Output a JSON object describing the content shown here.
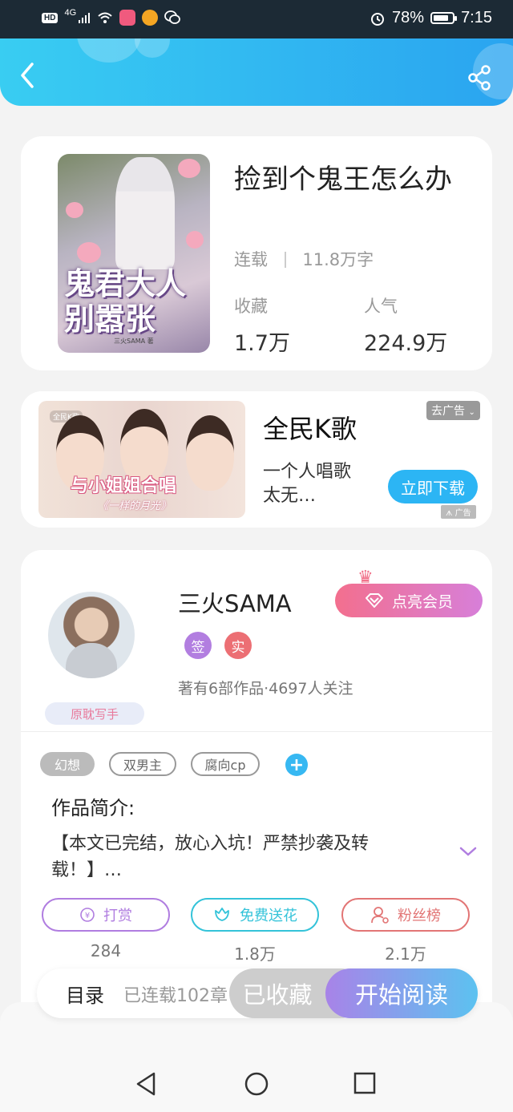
{
  "status_bar": {
    "left_labels": [
      "HD",
      "4G"
    ],
    "battery": "78%",
    "time": "7:15"
  },
  "header": {
    "back_icon": "chevron-left-icon",
    "share_icon": "share-icon"
  },
  "book": {
    "cover_title": "鬼君大人别嚣张",
    "cover_author": "三火SAMA 著",
    "title": "捡到个鬼王怎么办",
    "status": "连载",
    "word_count": "11.8万字",
    "collect_label": "收藏",
    "collect_value": "1.7万",
    "popularity_label": "人气",
    "popularity_value": "224.9万"
  },
  "ad": {
    "image_logo": "全民K歌",
    "image_slogan": "与小姐姐合唱",
    "image_sub": "《一样的月光》",
    "title": "全民K歌",
    "desc": "一个人唱歌太无…",
    "close_label": "去广告",
    "download_label": "立即下载",
    "ad_mark": "广告"
  },
  "author": {
    "name": "三火SAMA",
    "vip_label": "点亮会员",
    "badge_sign": "签",
    "badge_real": "实",
    "stats": "著有6部作品·4697人关注",
    "writer_tag": "原耽写手"
  },
  "tags": [
    "幻想",
    "双男主",
    "腐向cp"
  ],
  "intro": {
    "heading": "作品简介:",
    "text": "【本文已完结，放心入坑！严禁抄袭及转载！】…"
  },
  "actions": {
    "reward_label": "打赏",
    "reward_count": "284",
    "flower_label": "免费送花",
    "flower_count": "1.8万",
    "fans_label": "粉丝榜",
    "fans_count": "2.1万"
  },
  "bottom": {
    "toc_label": "目录",
    "chapter_status": "已连载102章",
    "collected_label": "已收藏",
    "read_label": "开始阅读"
  },
  "colors": {
    "header_gradient": [
      "#39cdf2",
      "#2aa4f0"
    ],
    "accent_blue": "#2cb5f4",
    "reward_purple": "#b07de0",
    "flower_cyan": "#34c3d9",
    "fans_red": "#e27575"
  }
}
